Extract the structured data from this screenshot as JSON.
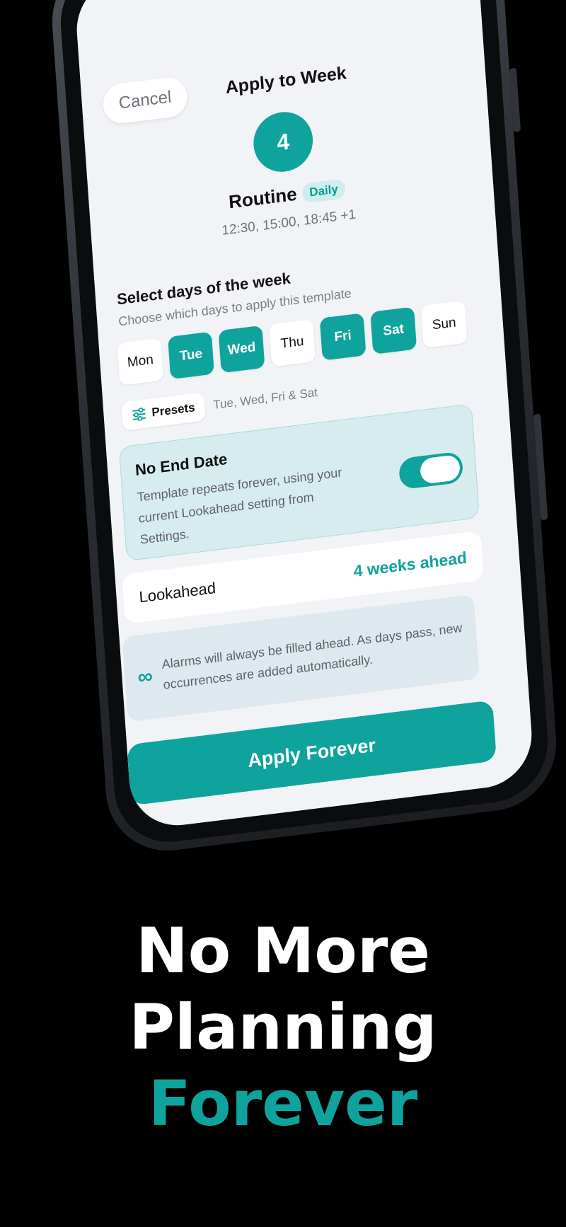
{
  "sheet": {
    "cancel_label": "Cancel",
    "title": "Apply to Week"
  },
  "routine": {
    "number": "4",
    "name": "Routine",
    "badge": "Daily",
    "times": "12:30, 15:00, 18:45 +1"
  },
  "days_section": {
    "title": "Select days of the week",
    "subtitle": "Choose which days to apply this template",
    "days": [
      {
        "label": "Mon",
        "selected": false
      },
      {
        "label": "Tue",
        "selected": true
      },
      {
        "label": "Wed",
        "selected": true
      },
      {
        "label": "Thu",
        "selected": false
      },
      {
        "label": "Fri",
        "selected": true
      },
      {
        "label": "Sat",
        "selected": true
      },
      {
        "label": "Sun",
        "selected": false
      }
    ],
    "presets_label": "Presets",
    "presets_value": "Tue, Wed, Fri & Sat"
  },
  "no_end_date": {
    "title": "No End Date",
    "description": "Template repeats forever, using your current Lookahead setting from Settings.",
    "enabled": true
  },
  "lookahead": {
    "label": "Lookahead",
    "value": "4 weeks ahead"
  },
  "info": {
    "icon": "infinity-icon",
    "text": "Alarms will always be filled ahead. As days pass, new occurrences are added automatically."
  },
  "apply_button_label": "Apply Forever",
  "headline": {
    "line1": "No More",
    "line2": "Planning",
    "line3": "Forever"
  },
  "colors": {
    "accent": "#0fa39d",
    "background": "#000000",
    "screen": "#f2f3f6"
  }
}
